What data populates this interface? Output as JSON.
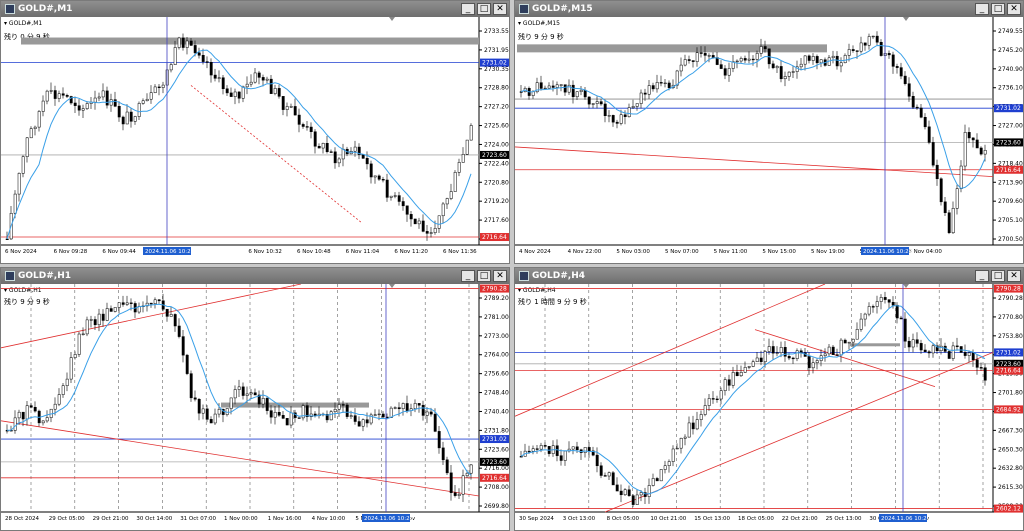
{
  "windows": [
    {
      "title": "GOLD#,M1",
      "symbol_label": "GOLD#,M1",
      "remain_text": "残り 0 分 9 秒",
      "price_labels": [
        "2733.55",
        "2731.95",
        "2730.35",
        "2728.80",
        "2727.20",
        "2725.60",
        "2724.00",
        "2722.40",
        "2720.80",
        "2719.20",
        "2717.60",
        "2716.00"
      ],
      "time_labels": [
        "6 Nov 2024",
        "6 Nov 09:28",
        "6 Nov 09:44",
        "6 Nov 10:00",
        "2024.11.06 10:20",
        "6 Nov 10:32",
        "6 Nov 10:48",
        "6 Nov 11:04",
        "6 Nov 11:20",
        "6 Nov 11:36"
      ],
      "badges": {
        "blue_level": "2731.02",
        "black_price": "2723.60",
        "red_level": "2716.64"
      }
    },
    {
      "title": "GOLD#,M15",
      "symbol_label": "GOLD#,M15",
      "remain_text": "残り 9 分 9 秒",
      "price_labels": [
        "2749.55",
        "2745.20",
        "2740.90",
        "2736.10",
        "2731.80",
        "2727.00",
        "2722.70",
        "2718.40",
        "2713.90",
        "2709.60",
        "2705.10",
        "2700.50"
      ],
      "time_labels": [
        "4 Nov 2024",
        "4 Nov 22:00",
        "5 Nov 03:00",
        "5 Nov 07:00",
        "5 Nov 11:00",
        "5 Nov 15:00",
        "5 Nov 19:00",
        "5 Nov 23:00",
        "6 Nov 04:00",
        "2024.11.06 10:20"
      ],
      "badges": {
        "blue_level": "2731.02",
        "black_price": "2723.60",
        "red_level": "2716.64"
      }
    },
    {
      "title": "GOLD#,H1",
      "symbol_label": "GOLD#,H1",
      "remain_text": "残り 9 分 9 秒",
      "price_labels": [
        "2789.20",
        "2781.00",
        "2773.00",
        "2764.00",
        "2756.60",
        "2748.40",
        "2740.40",
        "2731.80",
        "2723.60",
        "2716.00",
        "2708.00",
        "2699.80"
      ],
      "time_labels": [
        "28 Oct 2024",
        "29 Oct 05:00",
        "29 Oct 21:00",
        "30 Oct 14:00",
        "31 Oct 07:00",
        "1 Nov 00:00",
        "1 Nov 16:00",
        "4 Nov 10:00",
        "5 Nov 03:00",
        "6 Nov",
        "2024.11.06 10:20"
      ],
      "badges": {
        "pink_level": "2790.28",
        "blue_level": "2731.02",
        "black_price": "2723.60",
        "red_level": "2716.64"
      }
    },
    {
      "title": "GOLD#,H4",
      "symbol_label": "GOLD#,H4",
      "remain_text": "残り 1 時間 9 分 9 秒",
      "price_labels": [
        "2790.28",
        "2770.80",
        "2753.80",
        "2736.30",
        "2719.30",
        "2701.80",
        "2684.80",
        "2667.30",
        "2650.30",
        "2632.80",
        "2615.30",
        "2598.30"
      ],
      "time_labels": [
        "30 Sep 2024",
        "3 Oct 13:00",
        "8 Oct 05:00",
        "10 Oct 21:00",
        "15 Oct 13:00",
        "18 Oct 05:00",
        "22 Oct 21:00",
        "25 Oct 13:00",
        "30 Oct 04:00",
        "1 Nov",
        "2024.11.06 10:20"
      ],
      "badges": {
        "pink_level": "2790.28",
        "blue_level": "2731.02",
        "black_price": "2723.60",
        "red_level": "2716.64",
        "red_level2": "2684.92",
        "red_level3": "2602.12"
      }
    }
  ],
  "colors": {
    "ma": "#3aa0e8",
    "hline_blue": "#1f3fd0",
    "hline_red": "#e03030",
    "cross": "#4040c0"
  }
}
